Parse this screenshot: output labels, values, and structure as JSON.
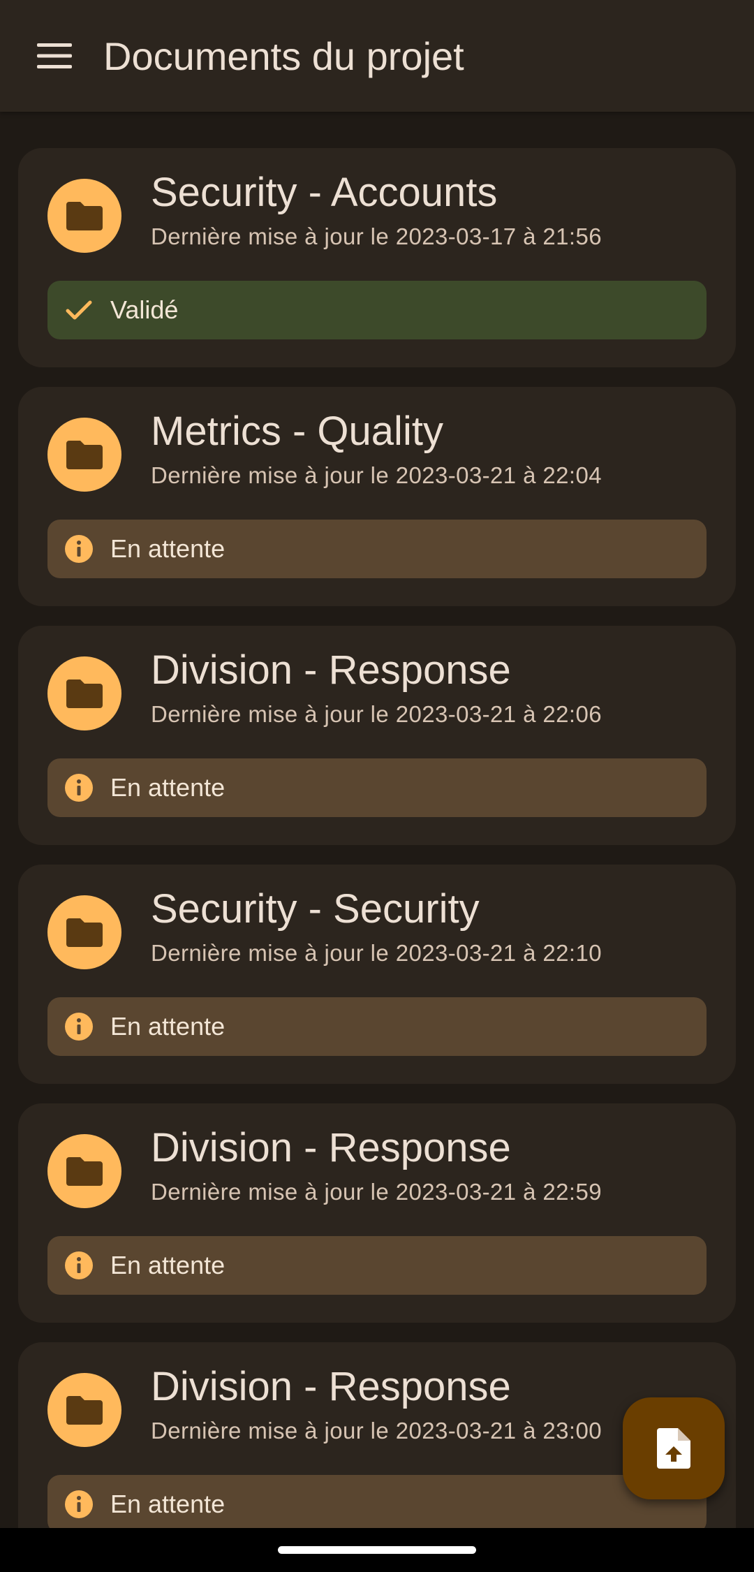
{
  "app_bar": {
    "title": "Documents du projet",
    "menu_icon": "menu-icon"
  },
  "colors": {
    "accent": "#ffb95c",
    "valid_chip": "#3d4a2a",
    "pending_chip": "#5a4630",
    "fab": "#6a3e00"
  },
  "documents": [
    {
      "title": "Security - Accounts",
      "subtitle": "Dernière mise à jour le 2023-03-17 à 21:56",
      "status": "Validé",
      "status_type": "valid"
    },
    {
      "title": "Metrics - Quality",
      "subtitle": "Dernière mise à jour le 2023-03-21 à 22:04",
      "status": "En attente",
      "status_type": "pending"
    },
    {
      "title": "Division - Response",
      "subtitle": "Dernière mise à jour le 2023-03-21 à 22:06",
      "status": "En attente",
      "status_type": "pending"
    },
    {
      "title": "Security - Security",
      "subtitle": "Dernière mise à jour le 2023-03-21 à 22:10",
      "status": "En attente",
      "status_type": "pending"
    },
    {
      "title": "Division - Response",
      "subtitle": "Dernière mise à jour le 2023-03-21 à 22:59",
      "status": "En attente",
      "status_type": "pending"
    },
    {
      "title": "Division - Response",
      "subtitle": "Dernière mise à jour le 2023-03-21 à 23:00",
      "status": "En attente",
      "status_type": "pending"
    }
  ],
  "fab": {
    "icon": "upload-file-icon"
  }
}
